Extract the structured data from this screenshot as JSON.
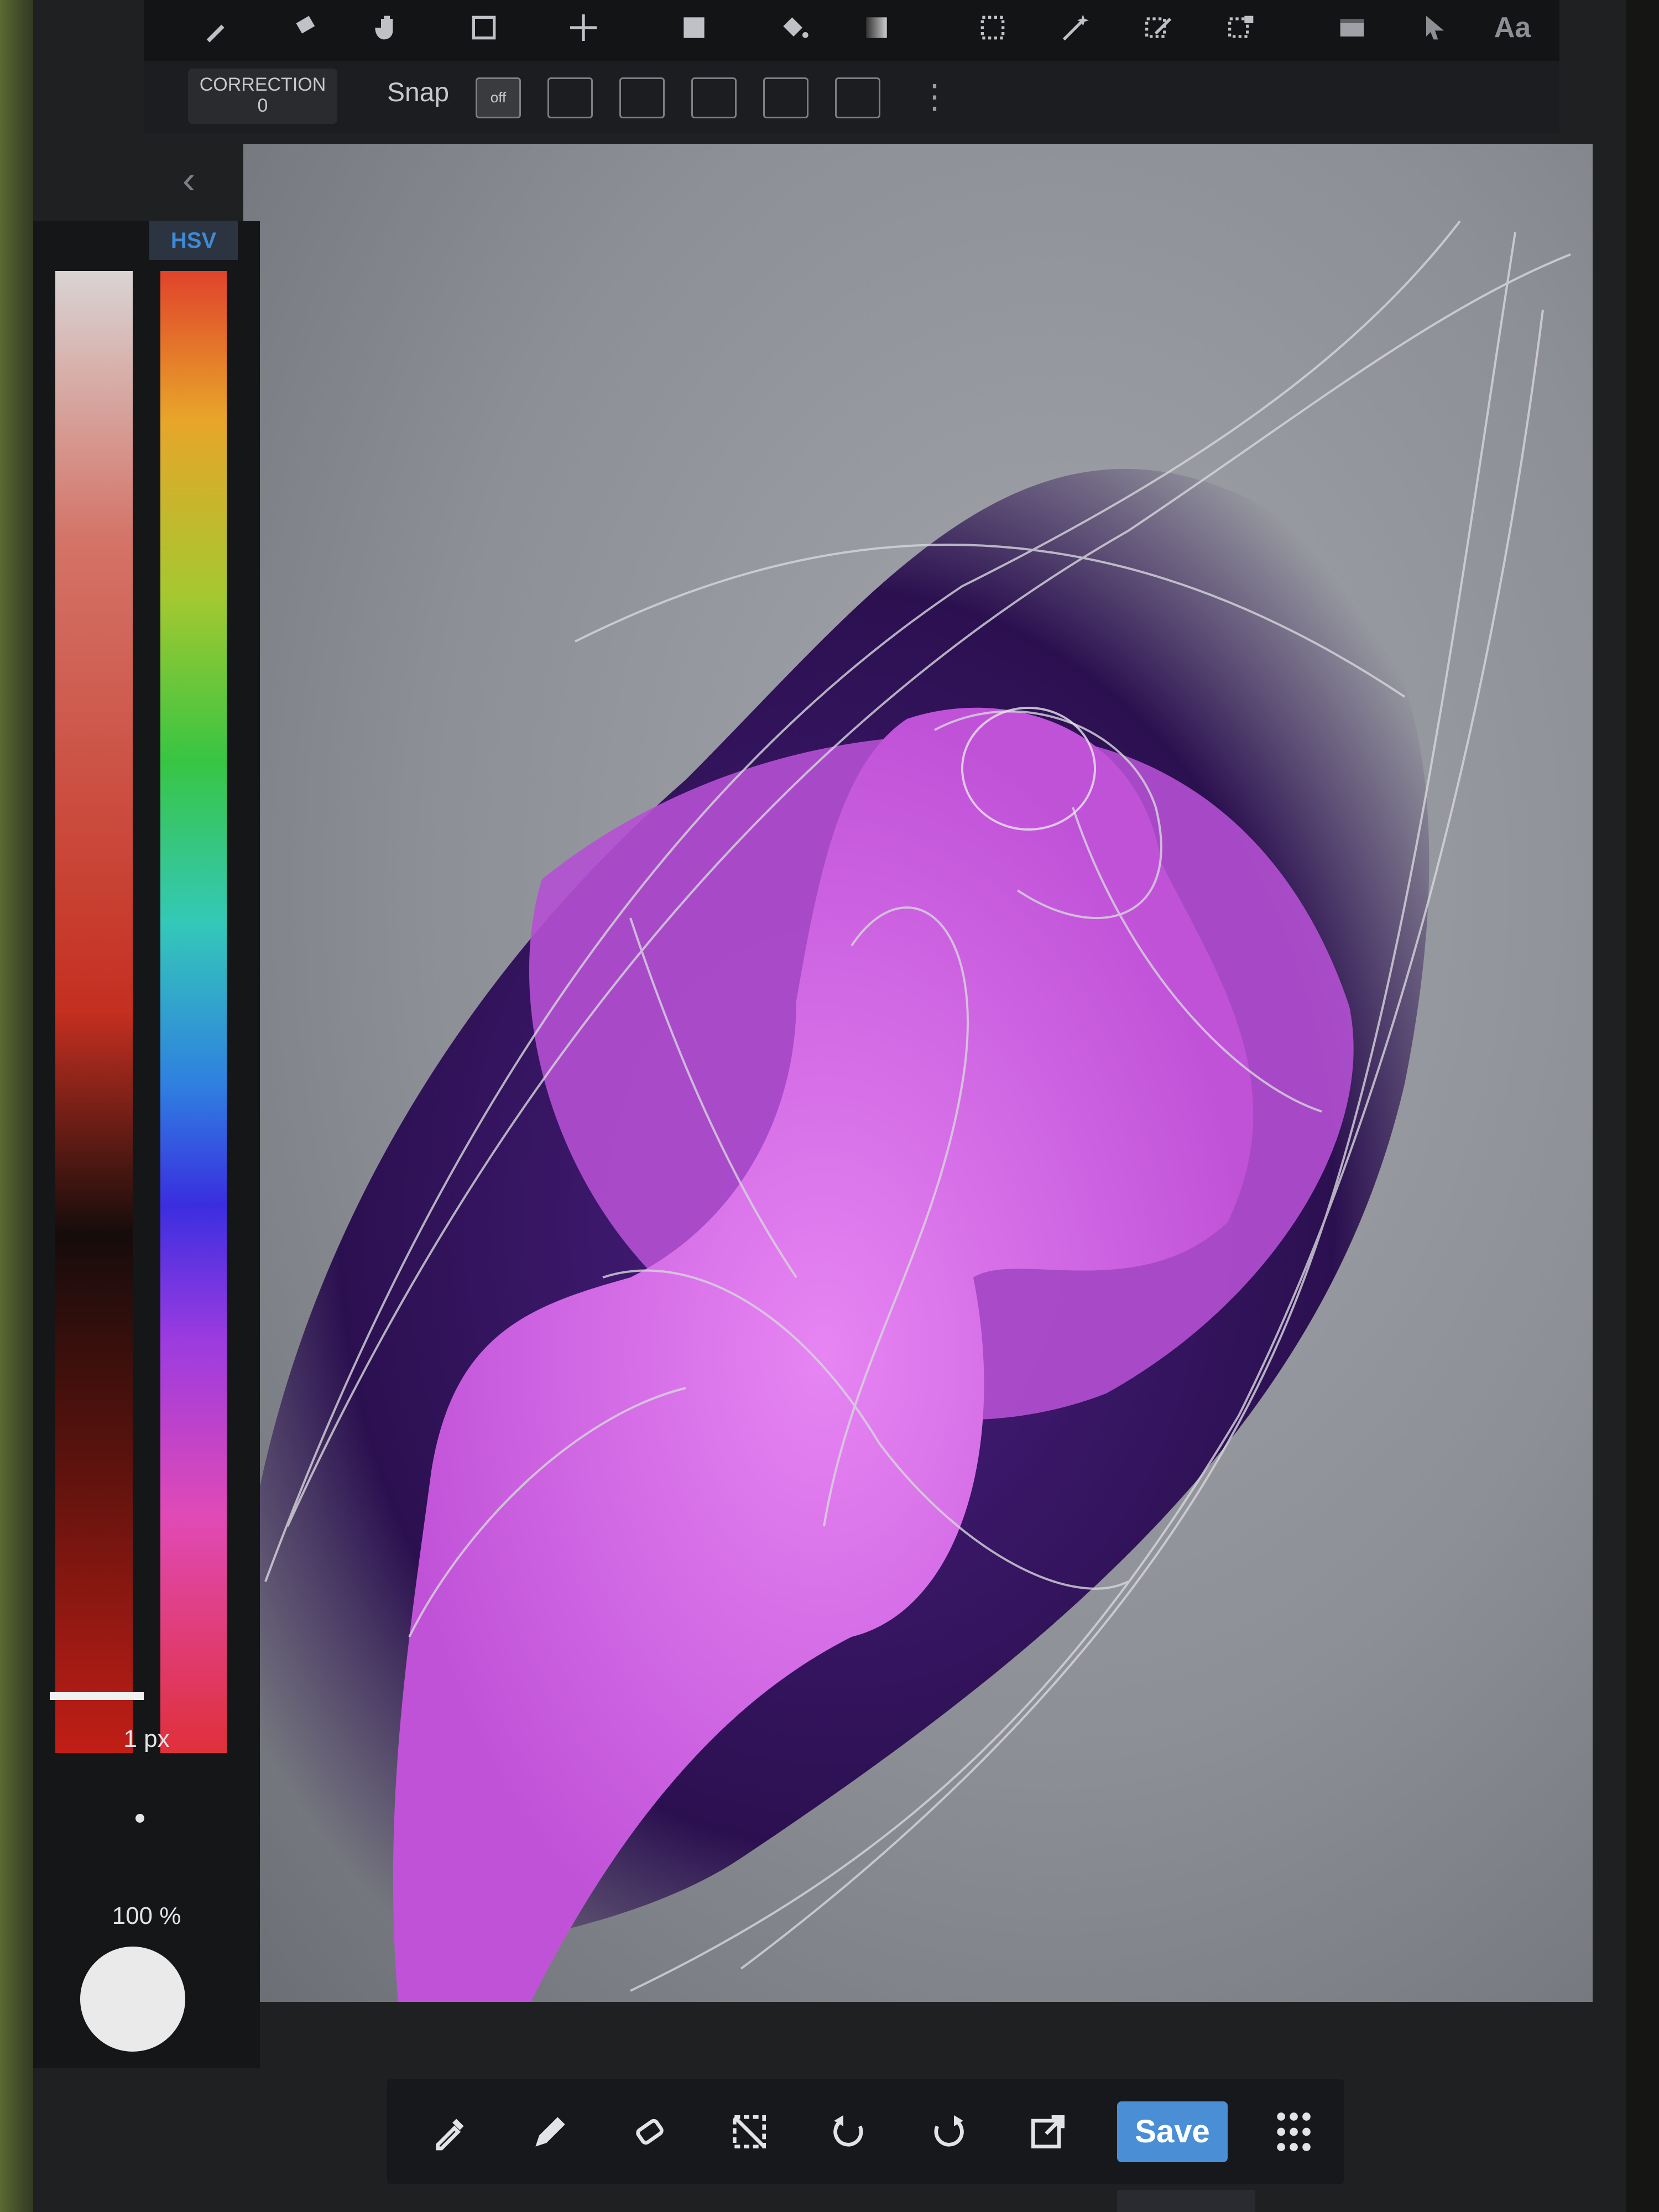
{
  "top_toolbar": {
    "tools": [
      "brush-icon",
      "eraser-icon",
      "hand-icon",
      "rectangle-icon",
      "move-icon",
      "fill-rect-icon",
      "bucket-icon",
      "gradient-icon",
      "select-icon",
      "magic-wand-icon",
      "select-pen-icon",
      "select-eraser-icon",
      "layer-icon",
      "pointer-icon"
    ],
    "fonts_label": "Aa"
  },
  "sub_toolbar": {
    "correction_label": "CORRECTION",
    "correction_value": "0",
    "snap_label": "Snap",
    "snap_off_label": "off"
  },
  "color_panel": {
    "mode_tab": "HSV",
    "brush_size": "1 px",
    "opacity": "100 %",
    "current_color": "#ebeaeb"
  },
  "bottom_toolbar": {
    "tools": [
      "eyedropper-icon",
      "pen-icon",
      "eraser-icon",
      "clear-selection-icon",
      "undo-icon",
      "redo-icon",
      "export-icon"
    ],
    "save_label": "Save"
  },
  "colors": {
    "accent": "#4a8fd6",
    "figure": "#d86ee8",
    "background_dark": "#3a1a66"
  }
}
